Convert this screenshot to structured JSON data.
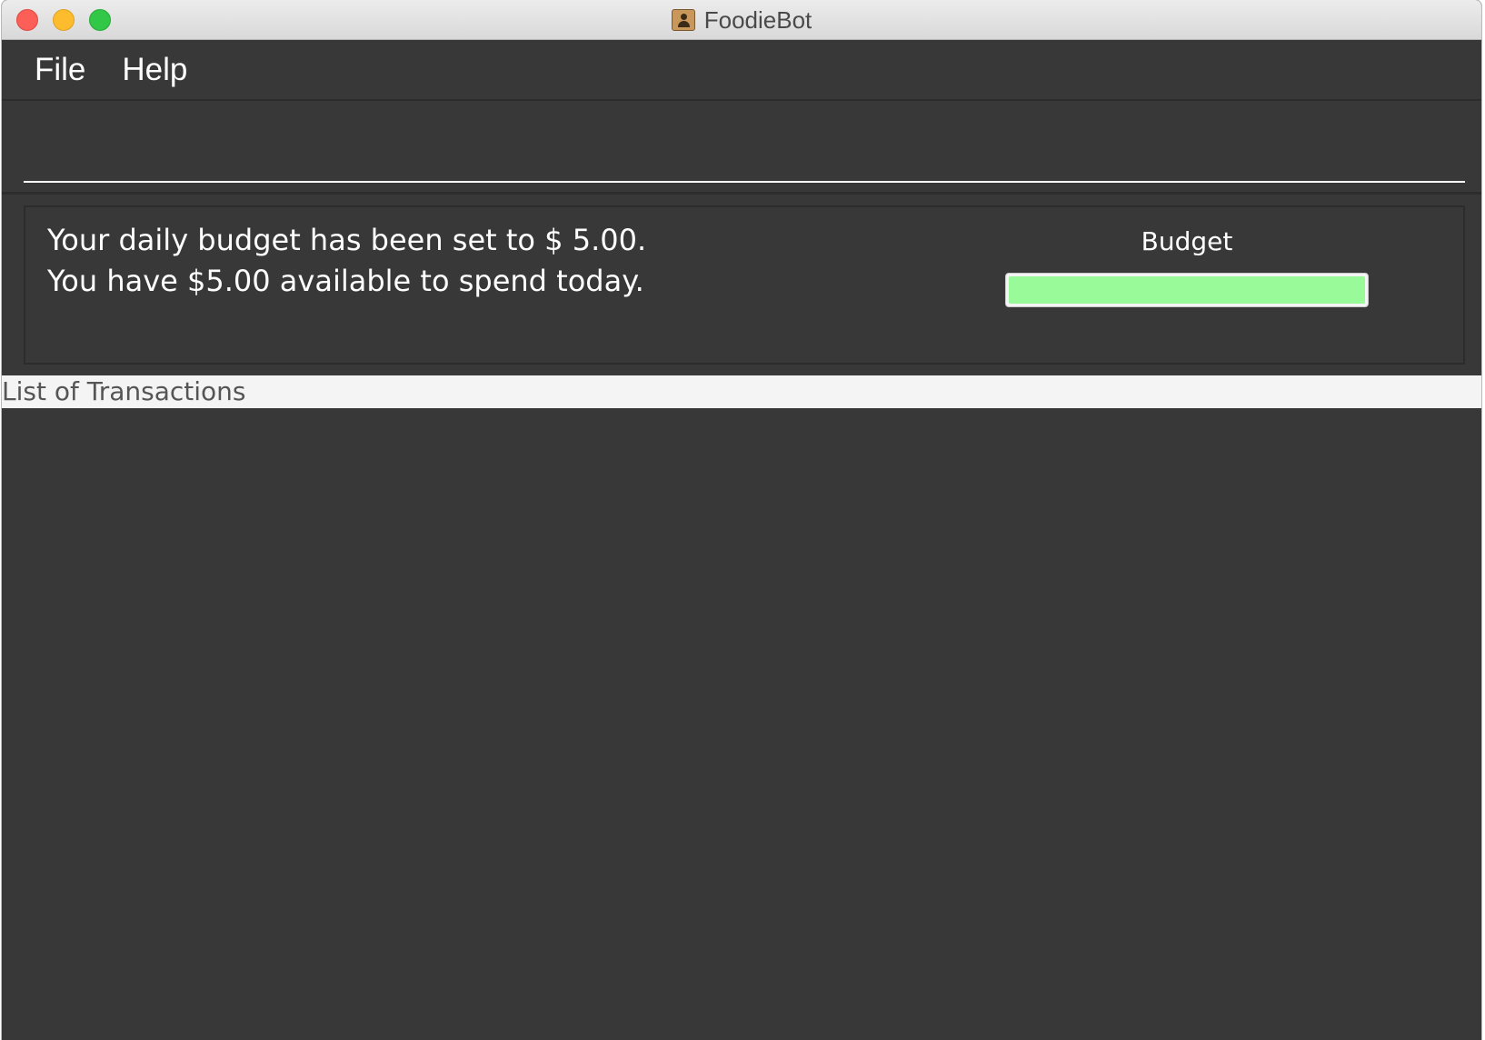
{
  "window": {
    "title": "FoodieBot",
    "app_icon": "addressbook-icon"
  },
  "menubar": {
    "items": [
      {
        "label": "File"
      },
      {
        "label": "Help"
      }
    ]
  },
  "command_box": {
    "value": "",
    "placeholder": ""
  },
  "result": {
    "message": "Your daily budget has been set to $ 5.00.\nYou have $5.00 available to spend today."
  },
  "budget": {
    "label": "Budget",
    "progress_fraction": 1.0,
    "fill_color": "#98fa98"
  },
  "transactions": {
    "header": "List of Transactions",
    "items": []
  },
  "colors": {
    "background": "#383838",
    "accent_green": "#98fa98",
    "text": "#ffffff"
  }
}
